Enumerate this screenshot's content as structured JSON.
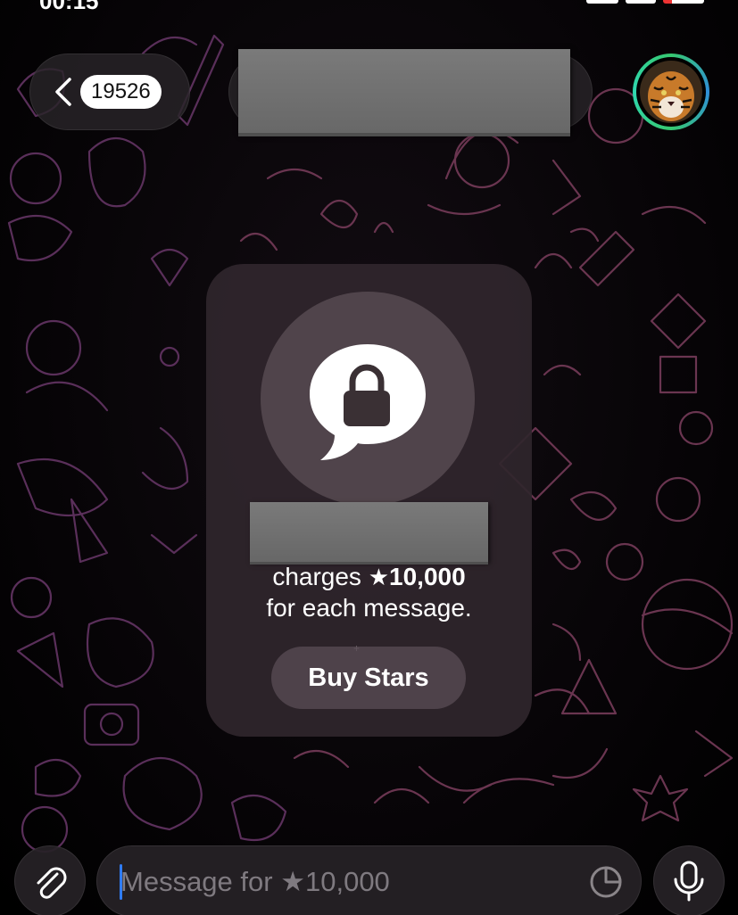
{
  "status_bar": {
    "time": "00:15"
  },
  "header": {
    "back_label": "",
    "unread_count": "19526"
  },
  "paywall_card": {
    "charges_prefix": "charges",
    "star_glyph": "★",
    "price": "10,000",
    "per_message": "for each message.",
    "buy_button_label": "Buy Stars"
  },
  "composer": {
    "placeholder": "Message for ★10,000"
  },
  "colors": {
    "caret": "#2f7cf6",
    "card_bg": "#30262c",
    "avatar_ring": "#36c870"
  },
  "icons": {
    "back": "chevron-left-icon",
    "lock": "lock-speech-bubble-icon",
    "attach": "paperclip-icon",
    "sticker": "sticker-icon",
    "mic": "microphone-icon"
  }
}
